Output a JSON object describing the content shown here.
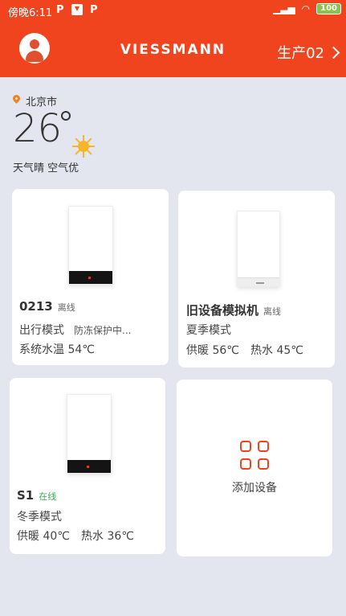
{
  "status_bar": {
    "time": "傍晚6:11",
    "notification_icons": [
      "P",
      "download",
      "P"
    ],
    "battery": "100"
  },
  "header": {
    "brand": "VIESSMANN",
    "location_selector": "生产02"
  },
  "weather": {
    "city": "北京市",
    "temperature": "26",
    "condition_icon": "sun-icon",
    "description": "天气晴 空气优"
  },
  "devices": [
    {
      "name": "0213",
      "status": "离线",
      "mode": "出行模式",
      "extra": "防冻保护中...",
      "line2": "系统水温  54℃"
    },
    {
      "name": "旧设备模拟机",
      "status": "离线",
      "mode": "夏季模式",
      "line2_a": "供暖  56℃",
      "line2_b": "热水  45℃"
    },
    {
      "name": "S1",
      "status": "在线",
      "mode": "冬季模式",
      "line2_a": "供暖  40℃",
      "line2_b": "热水  36℃"
    }
  ],
  "add_device": {
    "label": "添加设备"
  },
  "colors": {
    "brand": "#f0441f",
    "background": "#e3e6ee",
    "online": "#3caa5a"
  }
}
